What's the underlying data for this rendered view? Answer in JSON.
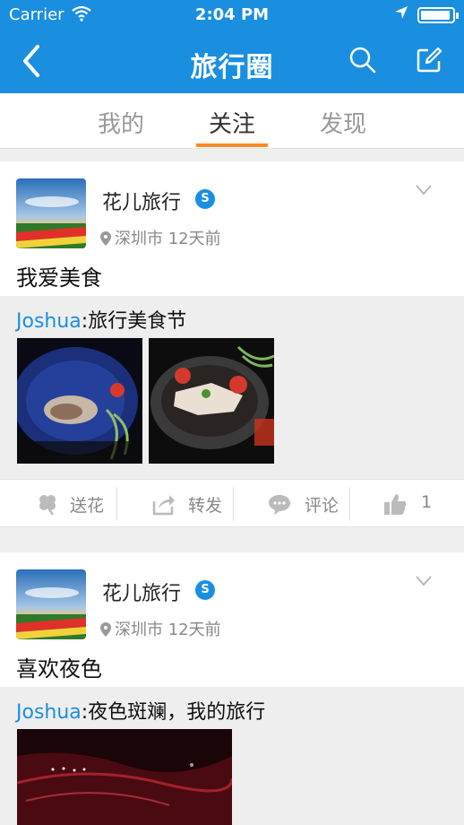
{
  "status_bar": {
    "carrier": "Carrier",
    "time": "2:04 PM"
  },
  "nav": {
    "title": "旅行圈"
  },
  "tabs": [
    {
      "label": "我的",
      "active": false
    },
    {
      "label": "关注",
      "active": true
    },
    {
      "label": "发现",
      "active": false
    }
  ],
  "posts": [
    {
      "author": "花儿旅行",
      "badge": "S",
      "location": "深圳市 12天前",
      "text": "我爱美食",
      "repost_user": "Joshua",
      "repost_text": ":旅行美食节",
      "actions": {
        "flower": "送花",
        "share": "转发",
        "comment": "评论",
        "likes": "1"
      }
    },
    {
      "author": "花儿旅行",
      "badge": "S",
      "location": "深圳市 12天前",
      "text": "喜欢夜色",
      "repost_user": "Joshua",
      "repost_text": ":夜色斑斓，我的旅行"
    }
  ],
  "colors": {
    "accent": "#1a8fe0",
    "tab_underline": "#f58a1f"
  }
}
